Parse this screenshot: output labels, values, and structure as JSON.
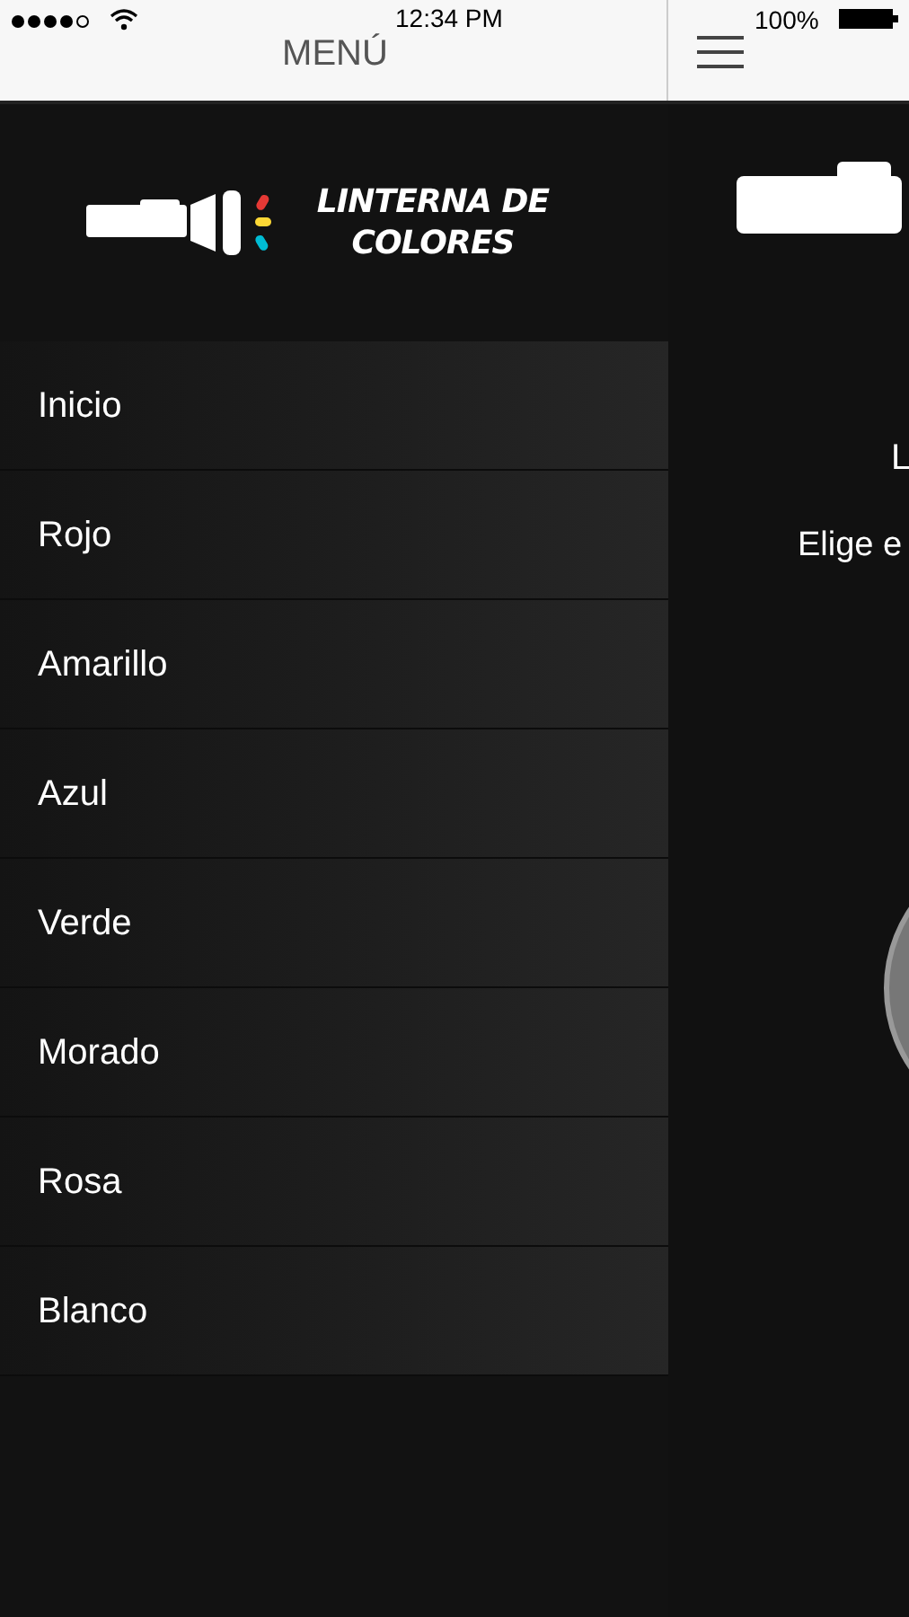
{
  "status_bar": {
    "time": "12:34 PM",
    "battery": "100%"
  },
  "menu_header": {
    "title": "MENÚ"
  },
  "brand": {
    "title": "LINTERNA DE COLORES"
  },
  "menu_items": [
    {
      "label": "Inicio"
    },
    {
      "label": "Rojo"
    },
    {
      "label": "Amarillo"
    },
    {
      "label": "Azul"
    },
    {
      "label": "Verde"
    },
    {
      "label": "Morado"
    },
    {
      "label": "Rosa"
    },
    {
      "label": "Blanco"
    }
  ],
  "main": {
    "heading": "L",
    "subtitle": "Elige e"
  }
}
